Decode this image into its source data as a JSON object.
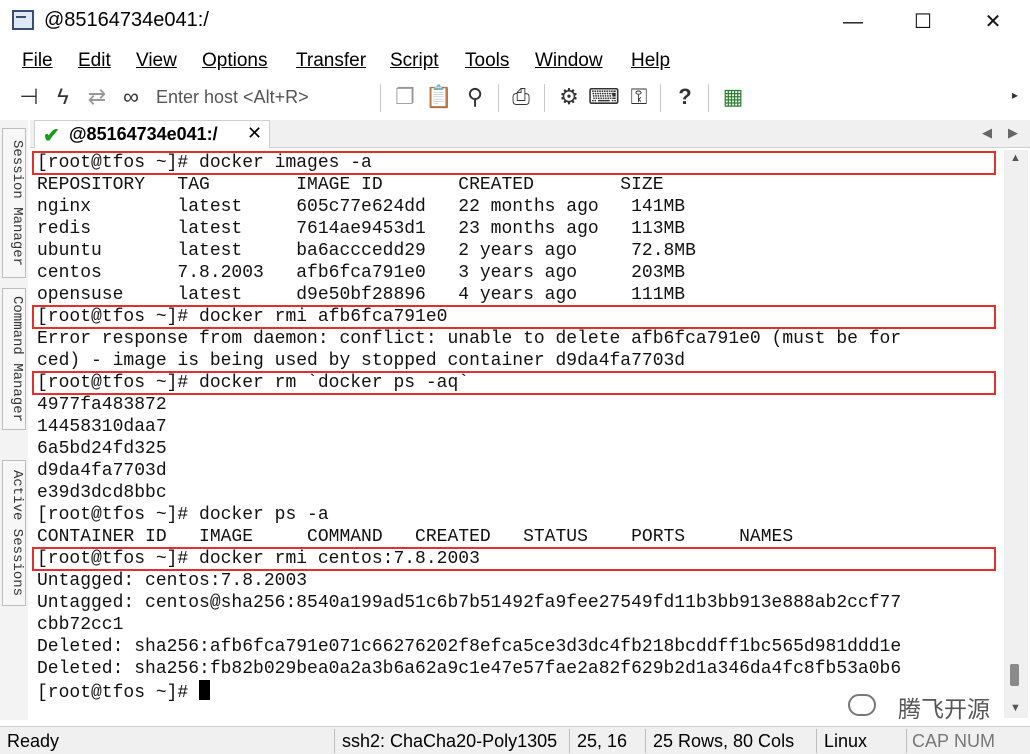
{
  "window": {
    "title": "@85164734e041:/",
    "minimize_glyph": "—",
    "maximize_glyph": "☐",
    "close_glyph": "✕"
  },
  "menu": [
    "File",
    "Edit",
    "View",
    "Options",
    "Transfer",
    "Script",
    "Tools",
    "Window",
    "Help"
  ],
  "toolbar": {
    "host_placeholder": "Enter host <Alt+R>",
    "icons": [
      "connect-bar-icon",
      "lightning-icon",
      "reconnect-icon",
      "link-icon",
      "copy-icon",
      "clipboard-icon",
      "find-icon",
      "print-icon",
      "settings-gear-icon",
      "keymap-icon",
      "key-icon",
      "help-icon",
      "sftp-icon"
    ]
  },
  "side_tabs": [
    "Session Manager",
    "Command Manager",
    "Active Sessions"
  ],
  "tab": {
    "label": "@85164734e041:/",
    "close_glyph": "✕",
    "status_color": "#1a9b1a"
  },
  "terminal": {
    "lines": [
      "[root@tfos ~]# docker images -a",
      "REPOSITORY   TAG        IMAGE ID       CREATED        SIZE",
      "nginx        latest     605c77e624dd   22 months ago   141MB",
      "redis        latest     7614ae9453d1   23 months ago   113MB",
      "ubuntu       latest     ba6acccedd29   2 years ago     72.8MB",
      "centos       7.8.2003   afb6fca791e0   3 years ago     203MB",
      "opensuse     latest     d9e50bf28896   4 years ago     111MB",
      "[root@tfos ~]# docker rmi afb6fca791e0",
      "Error response from daemon: conflict: unable to delete afb6fca791e0 (must be for",
      "ced) - image is being used by stopped container d9da4fa7703d",
      "[root@tfos ~]# docker rm `docker ps -aq`",
      "4977fa483872",
      "14458310daa7",
      "6a5bd24fd325",
      "d9da4fa7703d",
      "e39d3dcd8bbc",
      "[root@tfos ~]# docker ps -a",
      "CONTAINER ID   IMAGE     COMMAND   CREATED   STATUS    PORTS     NAMES",
      "[root@tfos ~]# docker rmi centos:7.8.2003",
      "Untagged: centos:7.8.2003",
      "Untagged: centos@sha256:8540a199ad51c6b7b51492fa9fee27549fd11b3bb913e888ab2ccf77",
      "cbb72cc1",
      "Deleted: sha256:afb6fca791e071c66276202f8efca5ce3d3dc4fb218bcddff1bc565d981ddd1e",
      "Deleted: sha256:fb82b029bea0a2a3b6a62a9c1e47e57fae2a82f629b2d1a346da4fc8fb53a0b6",
      "[root@tfos ~]# "
    ],
    "highlighted_lines": [
      0,
      7,
      10,
      18
    ],
    "highlight_color": "#e03030"
  },
  "watermark": "腾飞开源",
  "status": {
    "ready": "Ready",
    "cipher": "ssh2: ChaCha20-Poly1305",
    "position": "25, 16",
    "size": "25 Rows, 80 Cols",
    "os": "Linux",
    "caps": "CAP",
    "num": "NUM"
  }
}
